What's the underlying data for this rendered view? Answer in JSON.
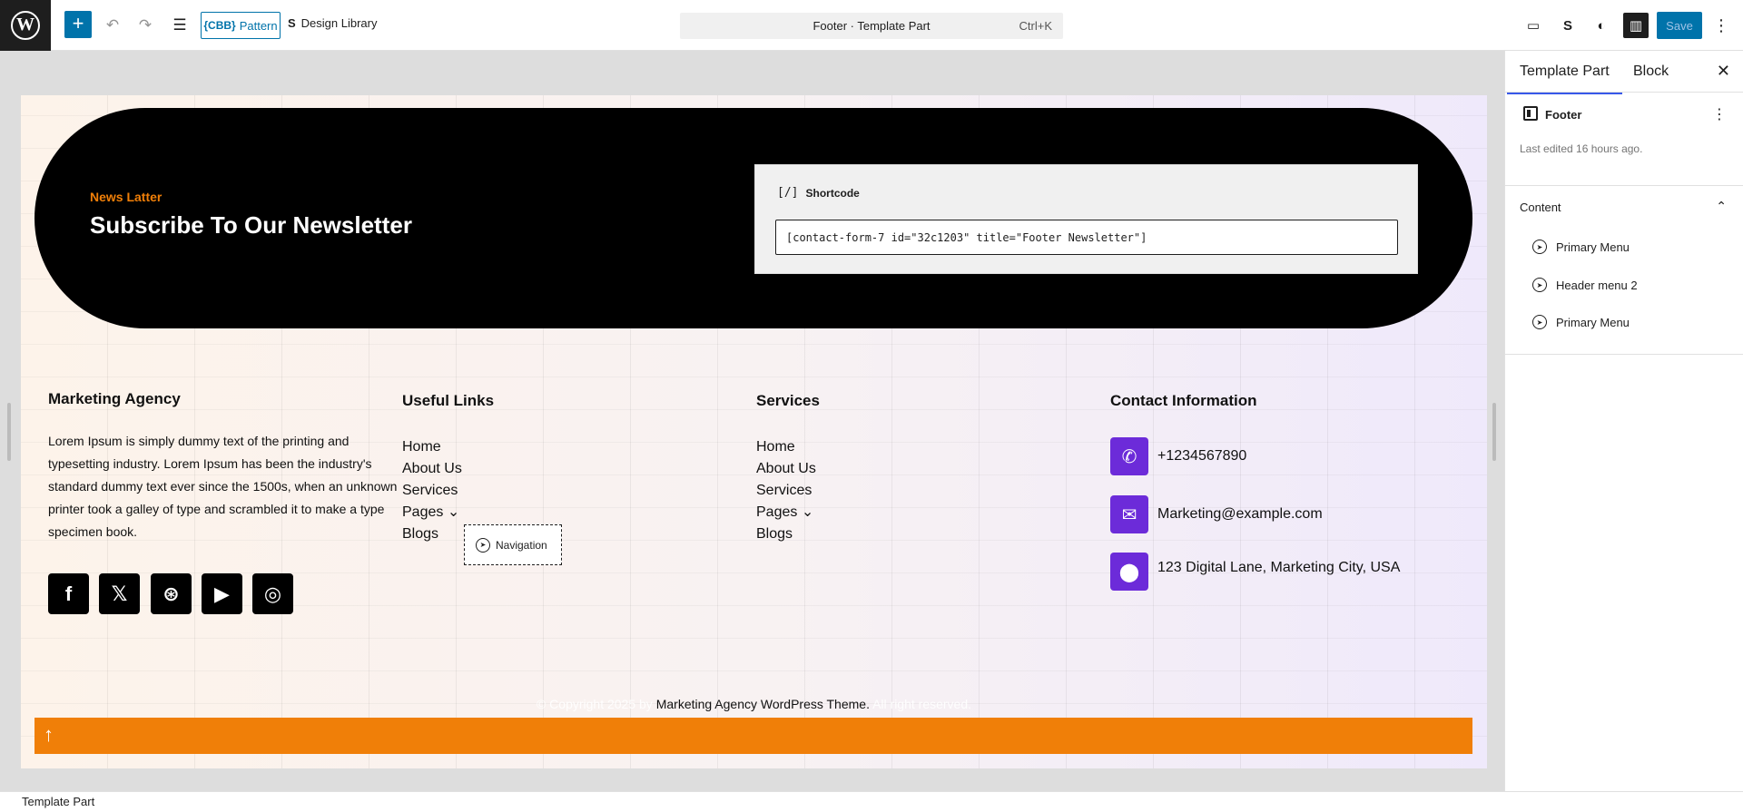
{
  "toolbar": {
    "logo": "W",
    "add_label": "+",
    "pattern_label": "Pattern",
    "pattern_badge": "{CBB}",
    "design_library_label": "Design Library",
    "command_title": "Footer · Template Part",
    "command_shortcut": "Ctrl+K",
    "save_label": "Save"
  },
  "newsletter": {
    "eyebrow": "News Latter",
    "title": "Subscribe To Our Newsletter",
    "shortcode_label": "Shortcode",
    "shortcode_icon": "[/]",
    "shortcode_value": "[contact-form-7 id=\"32c1203\" title=\"Footer Newsletter\"]"
  },
  "footer": {
    "about_title": "Marketing Agency",
    "about_text": "Lorem Ipsum is simply dummy text of the printing and typesetting industry. Lorem Ipsum has been the industry's standard dummy text ever since the 1500s, when an unknown printer took a galley of type and scrambled it to make a type specimen book.",
    "useful_links_title": "Useful Links",
    "useful_links": [
      "Home",
      "About Us",
      "Services",
      "Pages ⌄",
      "Blogs"
    ],
    "services_title": "Services",
    "services_links": [
      "Home",
      "About Us",
      "Services",
      "Pages ⌄",
      "Blogs"
    ],
    "navigation_badge": "Navigation",
    "contact_title": "Contact Information",
    "phone": "+1234567890",
    "email": "Marketing@example.com",
    "address": "123 Digital Lane, Marketing City, USA",
    "copyright_prefix": "© Copyright 2025 by ",
    "copyright_link": "Marketing Agency WordPress Theme.",
    "copyright_suffix": " All right reserved.",
    "social_icons": [
      "facebook-icon",
      "x-icon",
      "dribbble-icon",
      "youtube-icon",
      "instagram-icon"
    ]
  },
  "sidebar": {
    "tab_template_part": "Template Part",
    "tab_block": "Block",
    "block_title": "Footer",
    "last_edited": "Last edited 16 hours ago.",
    "content_label": "Content",
    "items": [
      "Primary Menu",
      "Header menu 2",
      "Primary Menu"
    ]
  },
  "statusbar": {
    "breadcrumb": "Template Part"
  },
  "colors": {
    "accent_blue": "#0073aa",
    "orange": "#f07f08",
    "purple": "#6c2bd9"
  }
}
